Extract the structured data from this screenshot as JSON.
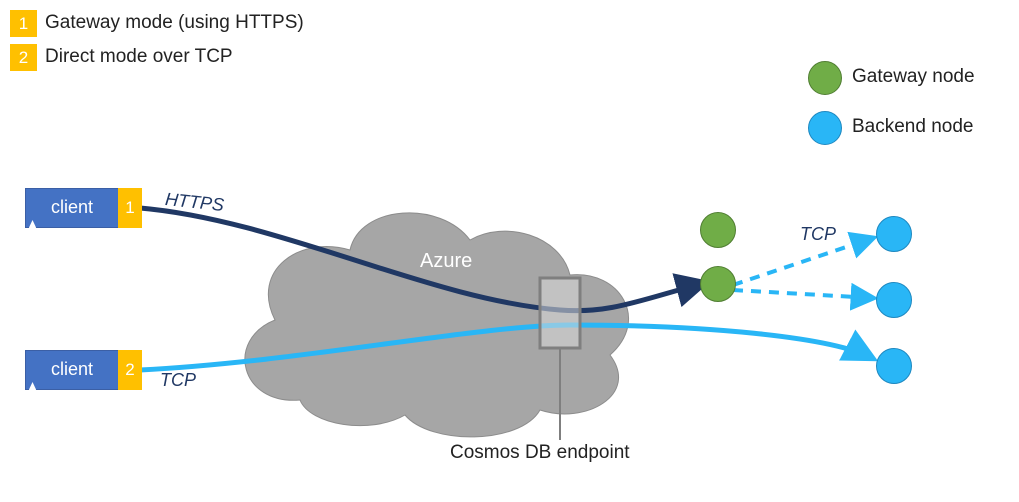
{
  "legend": {
    "items": [
      {
        "num": "1",
        "text": "Gateway mode (using HTTPS)"
      },
      {
        "num": "2",
        "text": "Direct mode over TCP"
      }
    ],
    "nodes": [
      {
        "kind": "gateway",
        "text": "Gateway node"
      },
      {
        "kind": "backend",
        "text": "Backend node"
      }
    ]
  },
  "clients": {
    "top": {
      "label": "client",
      "tag": "1",
      "protocol": "HTTPS"
    },
    "bottom": {
      "label": "client",
      "tag": "2",
      "protocol": "TCP"
    }
  },
  "cloud": {
    "label": "Azure"
  },
  "endpoint": {
    "label": "Cosmos DB endpoint"
  },
  "edges": {
    "tcp_label": "TCP"
  },
  "colors": {
    "https_line": "#203864",
    "tcp_line": "#29b6f6",
    "cloud_fill": "#a6a6a6",
    "orange": "#ffc000",
    "green": "#70ad47",
    "blue": "#29b6f6",
    "box_gray": "#7f7f7f"
  }
}
